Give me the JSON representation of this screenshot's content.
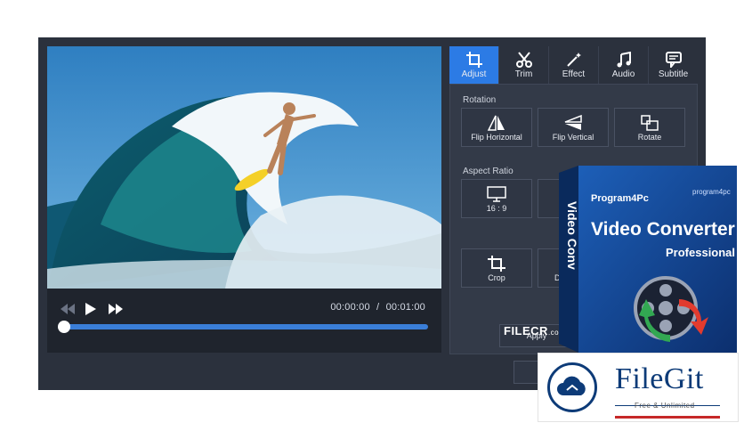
{
  "player": {
    "current_time": "00:00:00",
    "separator": "/",
    "total_time": "00:01:00",
    "progress": 0
  },
  "tabs": [
    {
      "label": "Adjust",
      "icon": "crop-icon",
      "active": true
    },
    {
      "label": "Trim",
      "icon": "scissors-icon"
    },
    {
      "label": "Effect",
      "icon": "magic-wand-icon"
    },
    {
      "label": "Audio",
      "icon": "music-note-icon"
    },
    {
      "label": "Subtitle",
      "icon": "subtitle-icon"
    }
  ],
  "rotation": {
    "label": "Rotation",
    "flip_horizontal": "Flip Horizontal",
    "flip_vertical": "Flip Vertical",
    "rotate": "Rotate"
  },
  "aspect": {
    "label": "Aspect Ratio",
    "ratio_169": "16 : 9"
  },
  "crop": {
    "label": "Crop",
    "partial_label": "D"
  },
  "apply_label": "Apply",
  "product_box": {
    "brand": "Program4Pc",
    "brand_small": "program4pc",
    "title": "Video Converter",
    "edition": "Professional",
    "spine": "Video Conv"
  },
  "watermark_filecr": {
    "text": "FILECR",
    "suffix": ".com"
  },
  "filegit": {
    "title": "FileGit",
    "subtitle": "Free & Unlimited"
  },
  "colors": {
    "accent": "#2c7be5",
    "app_bg": "#2b313d",
    "filegit_blue": "#0d3b78"
  }
}
